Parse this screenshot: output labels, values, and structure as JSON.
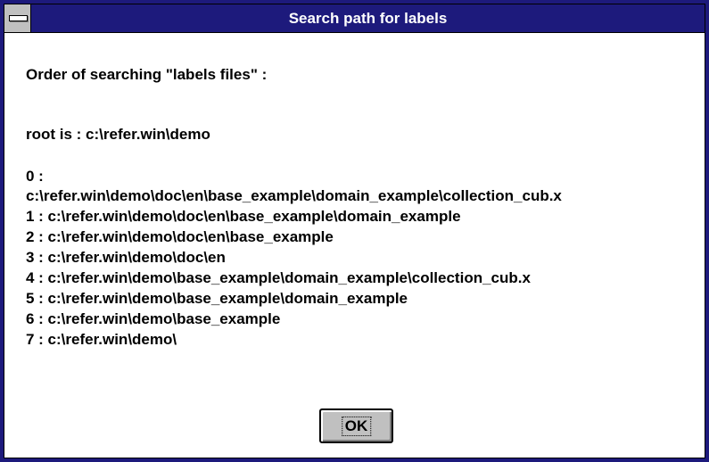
{
  "window": {
    "title": "Search path for labels"
  },
  "dialog": {
    "heading": "Order of searching \"labels files\" :",
    "root_line": "root is : c:\\refer.win\\demo",
    "paths": [
      "0 :",
      "c:\\refer.win\\demo\\doc\\en\\base_example\\domain_example\\collection_cub.x",
      "1 : c:\\refer.win\\demo\\doc\\en\\base_example\\domain_example",
      "2 : c:\\refer.win\\demo\\doc\\en\\base_example",
      "3 : c:\\refer.win\\demo\\doc\\en",
      "4 : c:\\refer.win\\demo\\base_example\\domain_example\\collection_cub.x",
      "5 : c:\\refer.win\\demo\\base_example\\domain_example",
      "6 : c:\\refer.win\\demo\\base_example",
      "7 : c:\\refer.win\\demo\\"
    ],
    "ok_label": "OK"
  },
  "colors": {
    "title_bar": "#1d1a7c",
    "title_text": "#ffffff",
    "button_face": "#c0c0c0"
  },
  "icons": {
    "system_menu": "system-menu-icon"
  }
}
